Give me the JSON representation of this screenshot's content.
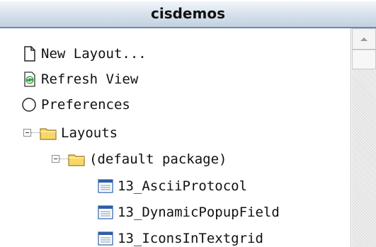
{
  "header": {
    "title": "cisdemos"
  },
  "tree": {
    "items": [
      {
        "label": "New Layout...",
        "icon": "new-document-icon"
      },
      {
        "label": "Refresh View",
        "icon": "refresh-icon"
      },
      {
        "label": "Preferences",
        "icon": "radio-circle-icon"
      },
      {
        "label": "Layouts",
        "icon": "folder-icon",
        "expanded": true
      },
      {
        "label": "(default package)",
        "icon": "folder-icon",
        "expanded": true
      },
      {
        "label": "13_AsciiProtocol",
        "icon": "layout-file-icon"
      },
      {
        "label": "13_DynamicPopupField",
        "icon": "layout-file-icon"
      },
      {
        "label": "13_IconsInTextgrid",
        "icon": "layout-file-icon"
      }
    ]
  },
  "colors": {
    "header_border": "#6f8aa6",
    "folder_yellow": "#f6d86a",
    "layout_blue": "#2d5fa8"
  }
}
